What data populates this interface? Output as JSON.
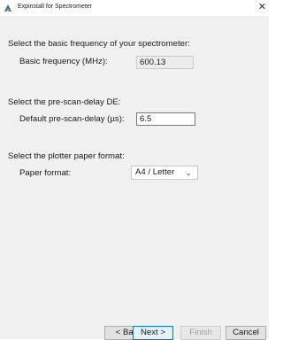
{
  "window": {
    "title": "Expinstall for Spectrometer",
    "close_glyph": "✕"
  },
  "sections": {
    "frequency": {
      "heading": "Select the basic frequency of your spectrometer:",
      "label": "Basic frequency (MHz):",
      "value": "600.13"
    },
    "prescan": {
      "heading": "Select the pre-scan-delay DE:",
      "label": "Default pre-scan-delay (µs):",
      "value": "6.5"
    },
    "paper": {
      "heading": "Select the plotter paper format:",
      "label": "Paper format:",
      "selected": "A4 / Letter",
      "chevron": "⌄"
    }
  },
  "buttons": {
    "back": "< Back",
    "next": "Next >",
    "finish": "Finish",
    "cancel": "Cancel"
  },
  "colors": {
    "accent": "#0078d7",
    "icon_blue": "#2b6cb0",
    "icon_orange": "#e8a33d"
  }
}
